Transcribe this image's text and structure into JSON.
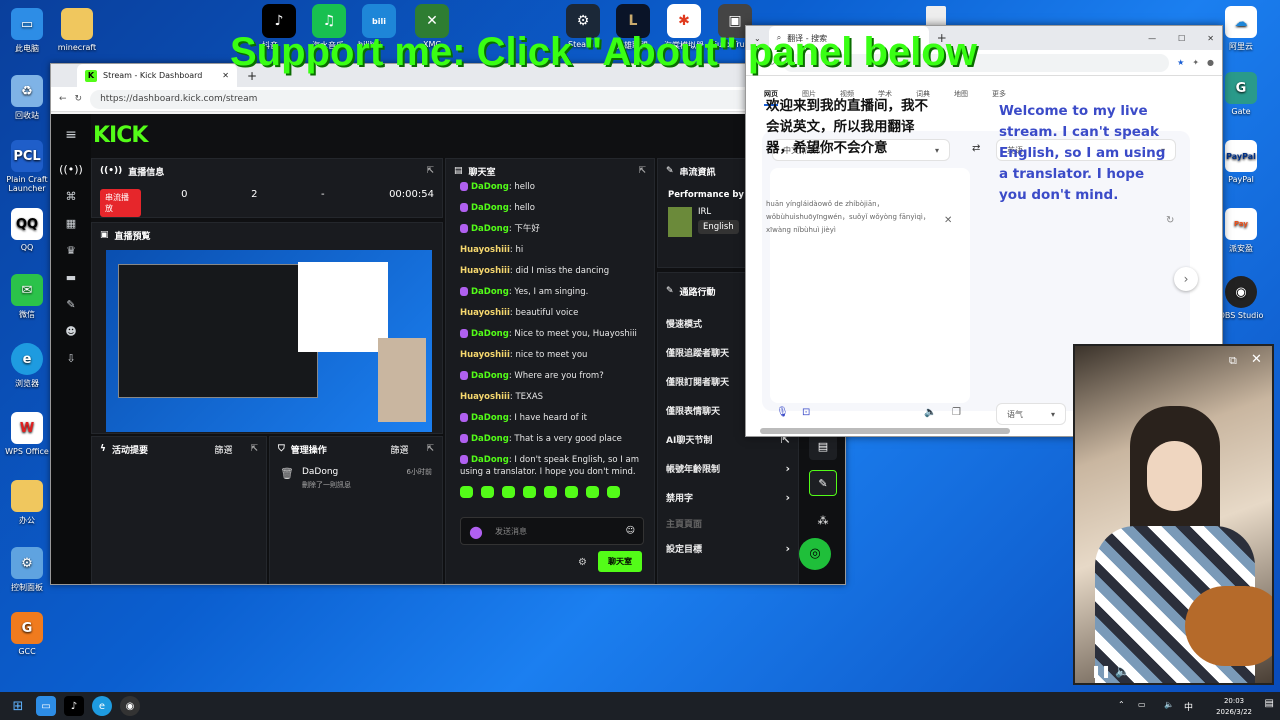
{
  "overlay": "Support me: Click \"About\" panel below",
  "desktop": {
    "left_icons": [
      "此电脑",
      "minecraft",
      "回收站",
      "Plain Craft Launcher",
      "QQ",
      "微信",
      "浏览器",
      "WPS Office",
      "办公",
      "控制面板",
      "GCC"
    ],
    "top_icons": [
      "抖音",
      "汽水音乐",
      "bilibili",
      "XMC",
      "Steam",
      "英雄联盟",
      "海棠模拟器",
      "Euro Truck"
    ],
    "right_icons": [
      "阿里云",
      "Gate",
      "PayPal",
      "派安盈",
      "OBS Studio"
    ]
  },
  "kick_browser": {
    "tab_title": "Stream - Kick Dashboard",
    "url": "https://dashboard.kick.com/stream",
    "logo": "KICK",
    "stream_info": {
      "title": "直播信息",
      "live_badge": "串流播放",
      "values": [
        "0",
        "2",
        "-",
        "00:00:54"
      ]
    },
    "preview": {
      "title": "直播預覧"
    },
    "activity": {
      "title": "活动提要",
      "filter": "篩選"
    },
    "mod": {
      "title": "管理操作",
      "filter": "篩選",
      "user": "DaDong",
      "time": "6小时前",
      "action": "刪除了一則訊息"
    },
    "chat": {
      "title": "聊天室",
      "messages": [
        {
          "user": "DaDong",
          "text": ": hello",
          "mic": true
        },
        {
          "user": "DaDong",
          "text": ": hello",
          "mic": true
        },
        {
          "user": "DaDong",
          "text": ": 下午好",
          "mic": true
        },
        {
          "user": "Huayoshiii",
          "text": ": hi",
          "mic": false
        },
        {
          "user": "Huayoshiii",
          "text": ": did I miss the dancing",
          "mic": false
        },
        {
          "user": "DaDong",
          "text": ": Yes, I am singing.",
          "mic": true
        },
        {
          "user": "Huayoshiii",
          "text": ": beautiful voice",
          "mic": false
        },
        {
          "user": "DaDong",
          "text": ": Nice to meet you, Huayoshiii",
          "mic": true
        },
        {
          "user": "Huayoshiii",
          "text": ": nice to meet you",
          "mic": false
        },
        {
          "user": "DaDong",
          "text": ": Where are you from?",
          "mic": true
        },
        {
          "user": "Huayoshiii",
          "text": ": TEXAS",
          "mic": false
        },
        {
          "user": "DaDong",
          "text": ": I have heard of it",
          "mic": true
        },
        {
          "user": "DaDong",
          "text": ": That is a very good place",
          "mic": true
        },
        {
          "user": "DaDong",
          "text": ": I don't speak English, so I am using a translator. I hope you don't mind.",
          "mic": true
        }
      ],
      "placeholder": "发送消息",
      "send": "聊天室"
    },
    "stream_meta": {
      "title": "串流資訊",
      "heading": "Performance by beauty",
      "category": "IRL",
      "language": "English"
    },
    "quick_actions": {
      "title": "通路行動",
      "items": [
        "慢速模式",
        "僅限追蹤者聊天",
        "僅限訂閱者聊天",
        "僅限表情聊天",
        "AI聊天节制",
        "帳號年齡限制",
        "禁用字",
        "主頁頁面",
        "設定目標"
      ]
    }
  },
  "translator": {
    "tab_title": "翻译 - 搜索",
    "nav": [
      "网页",
      "图片",
      "视频",
      "学术",
      "词典",
      "地图",
      "更多"
    ],
    "source_lang": "中文 (简体)",
    "target_lang": "英语",
    "source_text": "欢迎来到我的直播间，我不会说英文，所以我用翻译器，希望你不会介意",
    "pinyin": "huān yíngláidàowǒ de zhíbòjiān，wǒbùhuìshuōyīngwén，suǒyǐ wǒyòng fānyìqì，xīwàng nǐbùhuì jièyì",
    "target_text": "Welcome to my live stream. I can't speak English, so I am using a translator. I hope you don't mind.",
    "tone_label": "语气"
  },
  "taskbar": {
    "time": "20:03",
    "date": "2026/3/22",
    "ime": "中"
  }
}
